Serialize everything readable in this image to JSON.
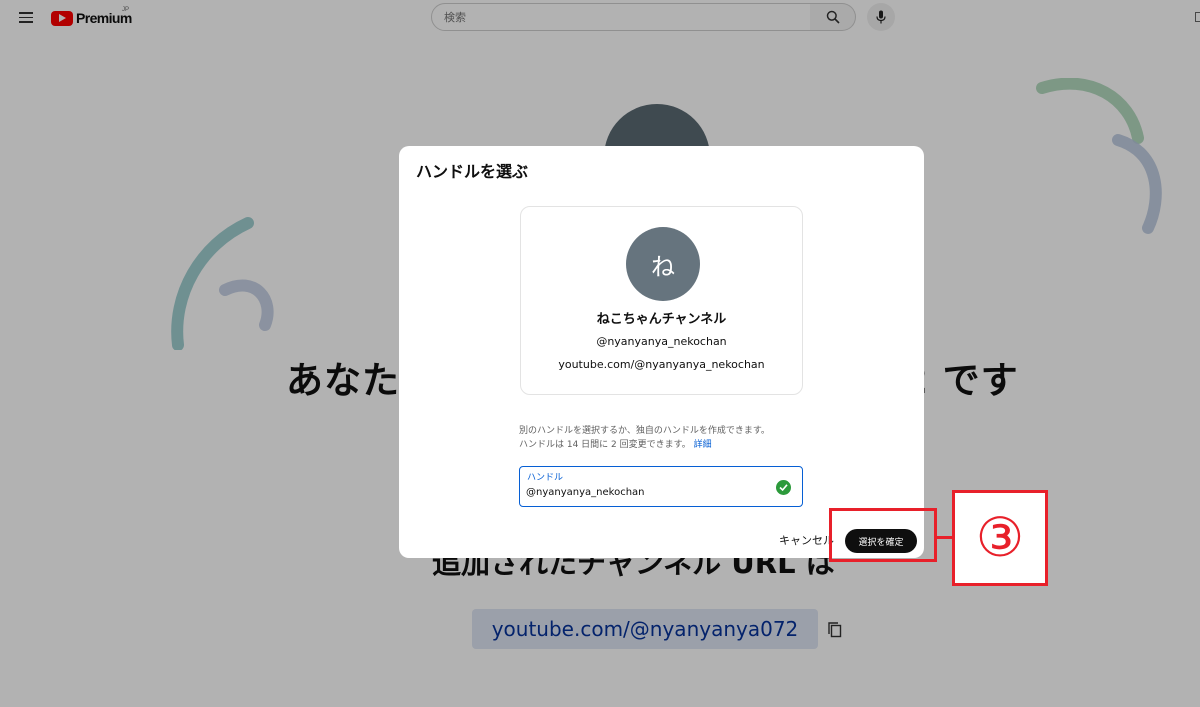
{
  "header": {
    "logo_text": "Premium",
    "region": "JP",
    "search_placeholder": "検索"
  },
  "background": {
    "heading_left": "あなた",
    "heading_right": "2 です",
    "subheading": "追加されたチャンネル URL は",
    "channel_url": "youtube.com/@nyanyanya072"
  },
  "dialog": {
    "title": "ハンドルを選ぶ",
    "preview": {
      "avatar_initial": "ね",
      "channel_name": "ねこちゃんチャンネル",
      "handle": "@nyanyanya_nekochan",
      "url": "youtube.com/@nyanyanya_nekochan"
    },
    "info_line1": "別のハンドルを選択するか、独自のハンドルを作成できます。",
    "info_line2": "ハンドルは 14 日間に 2 回変更できます。",
    "info_link": "詳細",
    "field_label": "ハンドル",
    "field_value": "@nyanyanya_nekochan",
    "cancel_label": "キャンセル",
    "confirm_label": "選択を確定"
  },
  "annotation": {
    "step_label": "③",
    "color": "#e8202a"
  },
  "colors": {
    "accent_blue": "#065fd4",
    "youtube_red": "#ff0000",
    "success_green": "#2c9a3b"
  }
}
